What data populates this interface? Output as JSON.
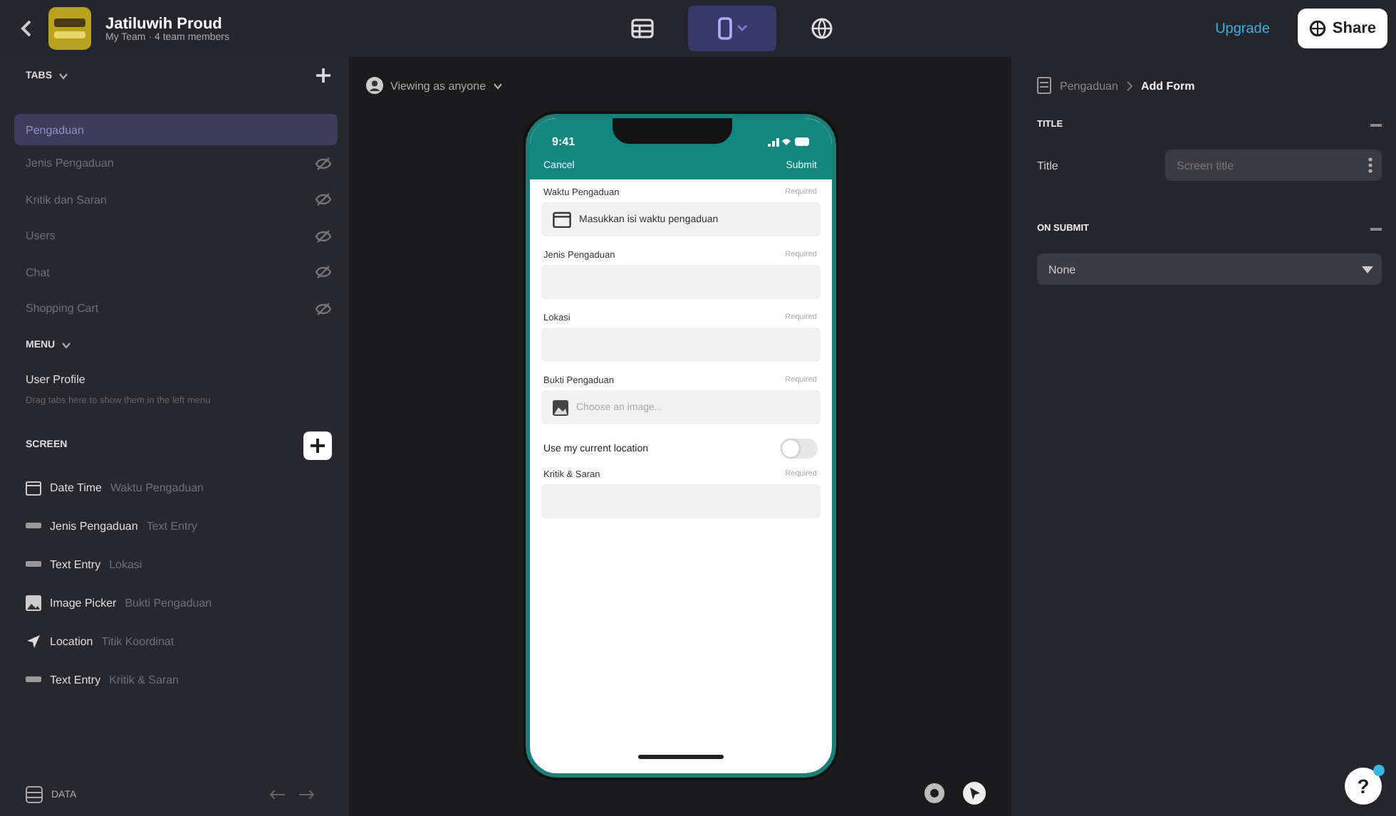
{
  "app": {
    "title": "Jatiluwih Proud",
    "subtitle": "My Team · 4 team members"
  },
  "modes": [
    {
      "kind": "table",
      "selected": false
    },
    {
      "kind": "phone",
      "selected": true
    },
    {
      "kind": "globe",
      "selected": false
    }
  ],
  "upgrade": "Upgrade",
  "share": "Share",
  "tabs_header": "TABS",
  "tabs": [
    {
      "label": "Pengaduan",
      "selected": true,
      "hidden": false
    },
    {
      "label": "Jenis Pengaduan",
      "selected": false,
      "hidden": true
    },
    {
      "label": "Kritik dan Saran",
      "selected": false,
      "hidden": true
    },
    {
      "label": "Users",
      "selected": false,
      "hidden": true
    },
    {
      "label": "Chat",
      "selected": false,
      "hidden": true
    },
    {
      "label": "Shopping Cart",
      "selected": false,
      "hidden": true
    }
  ],
  "menu_header": "MENU",
  "menu_items": [
    {
      "label": "User Profile"
    }
  ],
  "menu_hint": "Drag tabs here to show them in the left menu",
  "screen_header": "SCREEN",
  "components": [
    {
      "kind": "date",
      "type": "Date Time",
      "name": "Waktu Pengaduan"
    },
    {
      "kind": "text",
      "type": "Jenis Pengaduan",
      "name": "Text Entry"
    },
    {
      "kind": "text",
      "type": "Text Entry",
      "name": "Lokasi"
    },
    {
      "kind": "image",
      "type": "Image Picker",
      "name": "Bukti Pengaduan"
    },
    {
      "kind": "location",
      "type": "Location",
      "name": "Titik Koordinat"
    },
    {
      "kind": "text",
      "type": "Text Entry",
      "name": "Kritik & Saran"
    }
  ],
  "data_label": "DATA",
  "viewing": "Viewing as anyone",
  "phone": {
    "time": "9:41",
    "cancel": "Cancel",
    "submit": "Submit",
    "fields": [
      {
        "kind": "date",
        "label": "Waktu Pengaduan",
        "required": "Required",
        "placeholder": "Masukkan isi waktu pengaduan"
      },
      {
        "kind": "text",
        "label": "Jenis Pengaduan",
        "required": "Required"
      },
      {
        "kind": "text",
        "label": "Lokasi",
        "required": "Required"
      },
      {
        "kind": "image",
        "label": "Bukti Pengaduan",
        "required": "Required",
        "placeholder": "Choose an image..."
      },
      {
        "kind": "toggle",
        "label": "Use my current location",
        "on": false
      },
      {
        "kind": "text",
        "label": "Kritik & Saran",
        "required": "Required"
      }
    ]
  },
  "breadcrumb": {
    "parent": "Pengaduan",
    "current": "Add Form"
  },
  "title_section": {
    "header": "TITLE",
    "label": "Title",
    "placeholder": "Screen title"
  },
  "submit_section": {
    "header": "ON SUBMIT",
    "value": "None"
  },
  "help": "?"
}
